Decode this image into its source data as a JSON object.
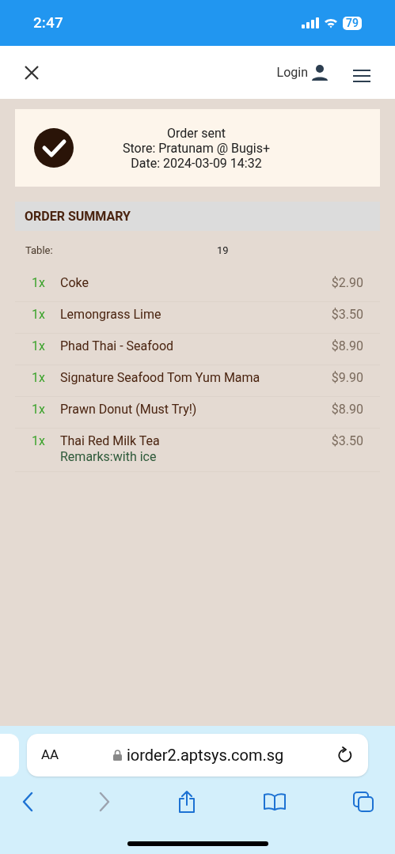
{
  "status_bar": {
    "time": "2:47",
    "battery": "79"
  },
  "header": {
    "login": "Login"
  },
  "order_status": {
    "title": "Order sent",
    "store": "Store: Pratunam @ Bugis+",
    "date": "Date: 2024-03-09 14:32"
  },
  "summary": {
    "title": "ORDER SUMMARY",
    "table_label": "Table:",
    "table_value": "19",
    "items": [
      {
        "qty": "1x",
        "name": "Coke",
        "price": "$2.90"
      },
      {
        "qty": "1x",
        "name": "Lemongrass Lime",
        "price": "$3.50"
      },
      {
        "qty": "1x",
        "name": "Phad Thai - Seafood",
        "price": "$8.90"
      },
      {
        "qty": "1x",
        "name": "Signature Seafood Tom Yum Mama",
        "price": "$9.90"
      },
      {
        "qty": "1x",
        "name": "Prawn Donut (Must Try!)",
        "price": "$8.90"
      },
      {
        "qty": "1x",
        "name": "Thai Red Milk Tea",
        "price": "$3.50",
        "remarks": "Remarks:with ice"
      }
    ]
  },
  "browser": {
    "text_size": "AA",
    "url": "iorder2.aptsys.com.sg",
    "toolbar": [
      {
        "kind": "back",
        "disabled": false
      },
      {
        "kind": "forward",
        "disabled": true
      },
      {
        "kind": "share",
        "disabled": false
      },
      {
        "kind": "bookmarks",
        "disabled": false
      },
      {
        "kind": "tabs",
        "disabled": false
      }
    ]
  }
}
